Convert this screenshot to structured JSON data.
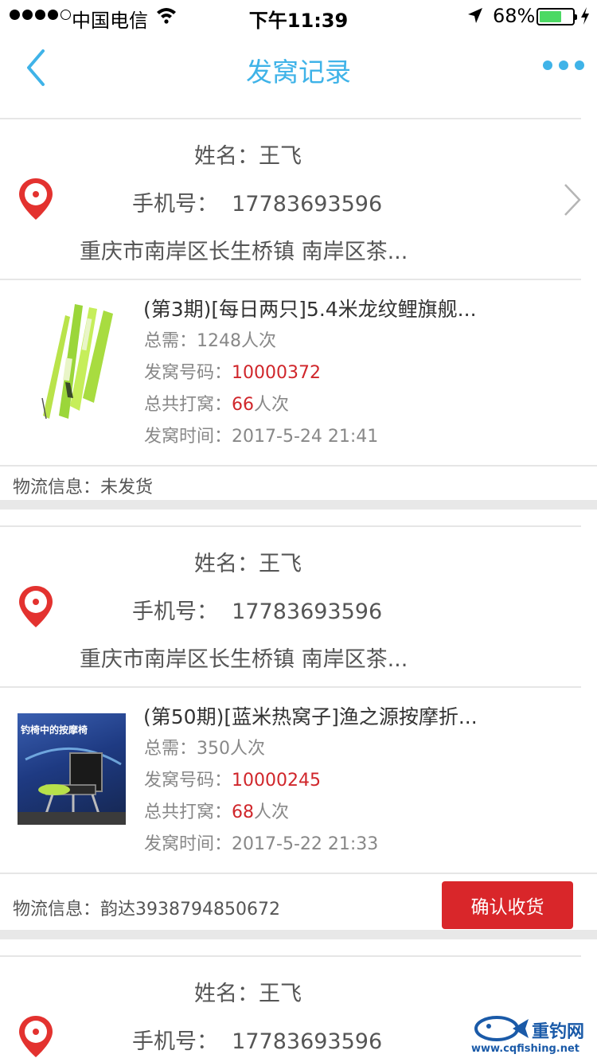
{
  "status_bar": {
    "carrier": "中国电信",
    "time": "下午11:39",
    "battery_percent": "68%",
    "battery_level": 0.68
  },
  "nav": {
    "title": "发窝记录",
    "back_icon": "chevron-left-icon",
    "more_icon": "more-dots-icon"
  },
  "records": [
    {
      "name_label": "姓名：",
      "name": "王飞",
      "phone_label": "手机号：",
      "phone": "17783693596",
      "address": "重庆市南岸区长生桥镇 南岸区茶...",
      "product_title": "(第3期)[每日两只]5.4米龙纹鲤旗舰...",
      "total_label": "总需：",
      "total_value": "1248人次",
      "code_label": "发窝号码：",
      "code_value": "10000372",
      "count_label": "总共打窝：",
      "count_value": "66",
      "count_unit": "人次",
      "time_label": "发窝时间：",
      "time_value": "2017-5-24 21:41",
      "logistics": "物流信息：未发货"
    },
    {
      "name_label": "姓名：",
      "name": "王飞",
      "phone_label": "手机号：",
      "phone": "17783693596",
      "address": "重庆市南岸区长生桥镇 南岸区茶...",
      "product_title": "(第50期)[蓝米热窝子]渔之源按摩折...",
      "product_image_text": "钓椅中的按摩椅",
      "total_label": "总需：",
      "total_value": "350人次",
      "code_label": "发窝号码：",
      "code_value": "10000245",
      "count_label": "总共打窝：",
      "count_value": "68",
      "count_unit": "人次",
      "time_label": "发窝时间：",
      "time_value": "2017-5-22 21:33",
      "logistics": "物流信息：韵达3938794850672",
      "confirm_label": "确认收货"
    },
    {
      "name_label": "姓名：",
      "name": "王飞",
      "phone_label": "手机号：",
      "phone": "17783693596"
    }
  ],
  "watermark": {
    "text": "重钓网",
    "url": "www.cqfishing.net"
  },
  "colors": {
    "accent": "#3fb3e8",
    "red": "#d0262b",
    "button": "#d9262a"
  }
}
